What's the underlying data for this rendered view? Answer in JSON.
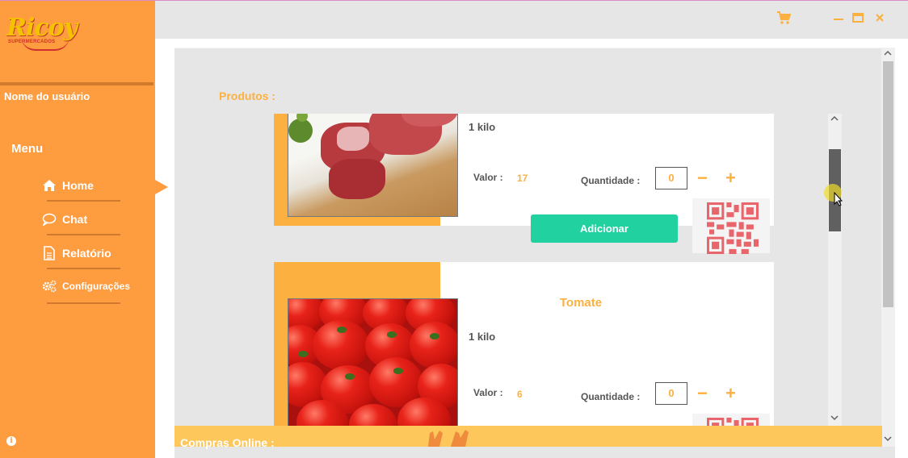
{
  "app": {
    "brand": "Ricoy",
    "brand_sub": "SUPERMERCADOS"
  },
  "sidebar": {
    "user_name": "Nome do usuário",
    "menu_title": "Menu",
    "items": [
      {
        "label": "Home",
        "icon": "home-icon"
      },
      {
        "label": "Chat",
        "icon": "chat-icon"
      },
      {
        "label": "Relatório",
        "icon": "report-icon"
      },
      {
        "label": "Configurações",
        "icon": "gears-icon"
      }
    ],
    "active_item": "Home"
  },
  "titlebar": {
    "cart_icon": "cart-icon",
    "minimize_icon": "minimize-icon",
    "maximize_icon": "maximize-icon",
    "close_icon": "close-icon"
  },
  "main": {
    "section_title": "Produtos :",
    "products": [
      {
        "name": "",
        "unit": "1 kilo",
        "valor_label": "Valor :",
        "valor": "17",
        "quantidade_label": "Quantidade :",
        "quantidade": "0",
        "add_label": "Adicionar",
        "image": "meat"
      },
      {
        "name": "Tomate",
        "unit": "1 kilo",
        "valor_label": "Valor :",
        "valor": "6",
        "quantidade_label": "Quantidade :",
        "quantidade": "0",
        "image": "tomatoes"
      }
    ],
    "minus_symbol": "−",
    "plus_symbol": "+"
  },
  "footer": {
    "title": "Compras Online :"
  },
  "colors": {
    "sidebar": "#fe9c40",
    "accent": "#fcb040",
    "add_button": "#21d19f",
    "footer": "#fdc75c",
    "qr": "#e8656b"
  }
}
